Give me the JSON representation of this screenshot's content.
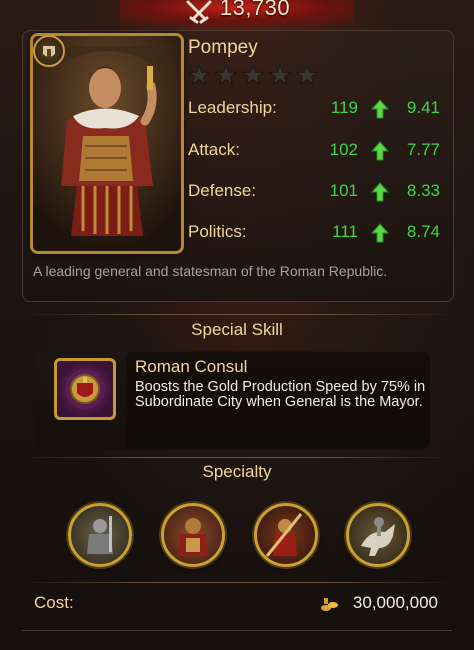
{
  "power": {
    "value": "13,730",
    "icon": "crossed-swords-icon"
  },
  "general": {
    "name": "Pompey",
    "star_count": 5,
    "stars_filled": 0,
    "description": "A leading general and statesman of the Roman Republic."
  },
  "stats": [
    {
      "label": "Leadership:",
      "value": "119",
      "growth": "9.41"
    },
    {
      "label": "Attack:",
      "value": "102",
      "growth": "7.77"
    },
    {
      "label": "Defense:",
      "value": "101",
      "growth": "8.33"
    },
    {
      "label": "Politics:",
      "value": "111",
      "growth": "8.74"
    }
  ],
  "special_skill": {
    "header": "Special Skill",
    "name": "Roman Consul",
    "description": "Boosts the Gold Production Speed by 75% in Subordinate City when General is the Mayor."
  },
  "specialty": {
    "header": "Specialty",
    "icons": [
      "infantry-knight-icon",
      "armored-warrior-icon",
      "spearman-icon",
      "cavalry-icon"
    ]
  },
  "cost": {
    "label": "Cost:",
    "value": "30,000,000",
    "icon": "gold-coin-icon"
  },
  "colors": {
    "gold_text": "#f0d69a",
    "stat_green": "#3fd34a",
    "frame_gold": "#b8892c",
    "banner_red": "#c2231a"
  }
}
